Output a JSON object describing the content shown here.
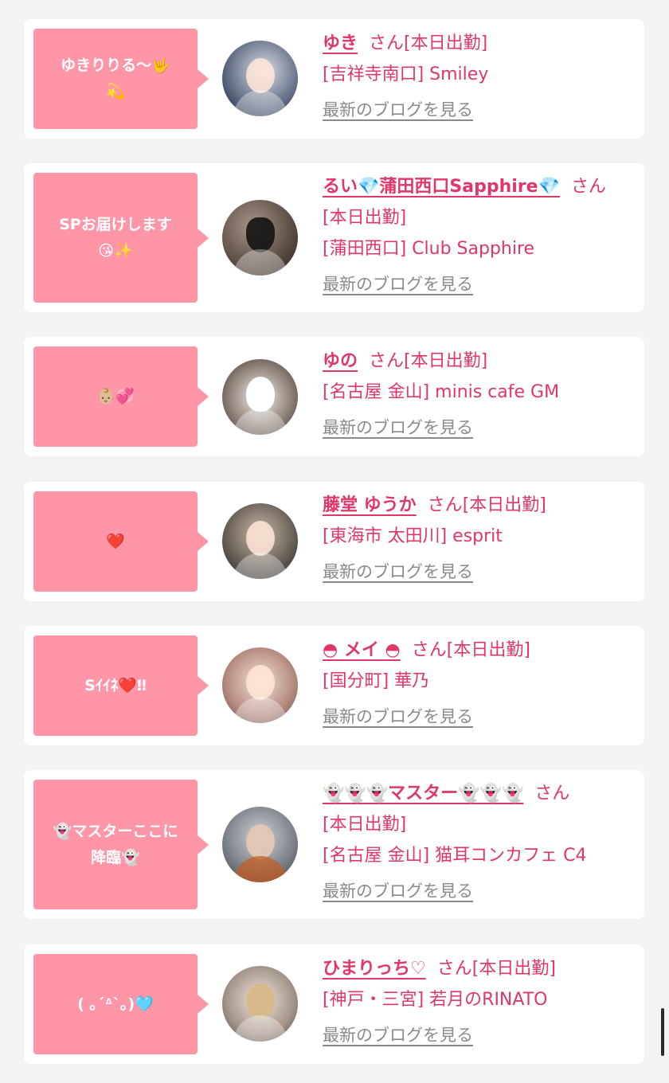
{
  "cards": [
    {
      "bubble": "ゆきりりる〜🤟\n💫",
      "name": "ゆき",
      "suffix": "さん",
      "status": "[本日出勤]",
      "shop": "[吉祥寺南口] Smiley",
      "blog": "最新のブログを見る"
    },
    {
      "bubble": "SPお届けします\n😘✨",
      "name": "るい💎蒲田西口Sapphire💎",
      "suffix": "さん",
      "status": "[本日出勤]",
      "shop": "[蒲田西口] Club Sapphire",
      "blog": "最新のブログを見る"
    },
    {
      "bubble": "👶🏼💞",
      "name": "ゆの",
      "suffix": "さん",
      "status": "[本日出勤]",
      "shop": "[名古屋 金山] minis cafe GM",
      "blog": "最新のブログを見る"
    },
    {
      "bubble": "❤️",
      "name": "藤堂 ゆうか",
      "suffix": "さん",
      "status": "[本日出勤]",
      "shop": "[東海市 太田川] esprit",
      "blog": "最新のブログを見る"
    },
    {
      "bubble": "Sｲｲﾈ❤️‼",
      "name": "◓ メイ ◓",
      "suffix": "さん",
      "status": "[本日出勤]",
      "shop": "[国分町] 華乃",
      "blog": "最新のブログを見る"
    },
    {
      "bubble": "👻マスターここに\n降臨👻",
      "name": "👻👻👻マスター👻👻👻",
      "suffix": "さん",
      "status": "[本日出勤]",
      "shop": "[名古屋 金山] 猫耳コンカフェ C4",
      "blog": "最新のブログを見る"
    },
    {
      "bubble": "( ｡´ᐞ`｡)🩵",
      "name": "ひまりっち♡",
      "suffix": "さん",
      "status": "[本日出勤]",
      "shop": "[神戸・三宮] 若月のRINATO",
      "blog": "最新のブログを見る"
    }
  ],
  "colors": {
    "accent": "#e0366a",
    "bubble": "#ff96a8",
    "page_bg": "#f3f3f3",
    "blog_link": "#8a8a8a"
  }
}
